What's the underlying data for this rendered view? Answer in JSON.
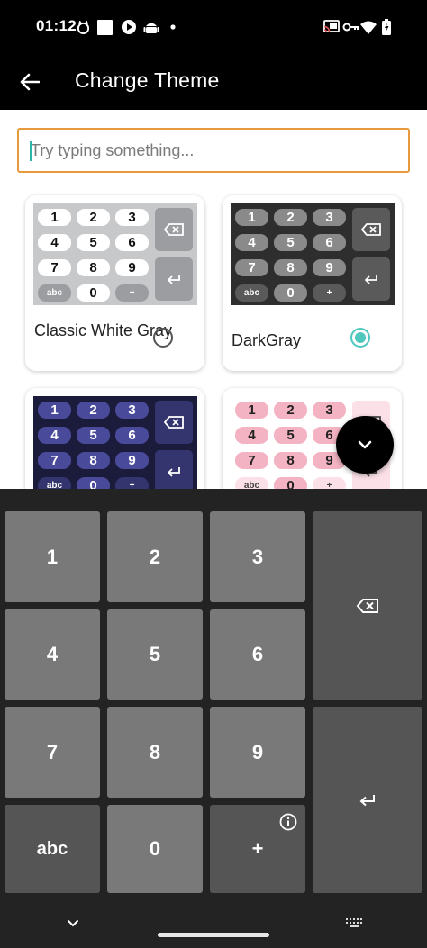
{
  "status_bar": {
    "time": "01:12"
  },
  "app_bar": {
    "title": "Change Theme"
  },
  "input": {
    "placeholder": "Try typing something..."
  },
  "themes": [
    {
      "name": "Classic White Gray",
      "selected": false,
      "keys": [
        "1",
        "2",
        "3",
        "4",
        "5",
        "6",
        "7",
        "8",
        "9",
        "abc",
        "0",
        "+"
      ]
    },
    {
      "name": "DarkGray",
      "selected": true,
      "keys": [
        "1",
        "2",
        "3",
        "4",
        "5",
        "6",
        "7",
        "8",
        "9",
        "abc",
        "0",
        "+"
      ]
    },
    {
      "name": "",
      "selected": false,
      "keys": [
        "1",
        "2",
        "3",
        "4",
        "5",
        "6",
        "7",
        "8",
        "9",
        "abc",
        "0",
        "+"
      ]
    },
    {
      "name": "",
      "selected": false,
      "keys": [
        "1",
        "2",
        "3",
        "4",
        "5",
        "6",
        "7",
        "8",
        "9",
        "abc",
        "0",
        "+"
      ]
    }
  ],
  "keyboard": {
    "keys": {
      "k1": "1",
      "k2": "2",
      "k3": "3",
      "k4": "4",
      "k5": "5",
      "k6": "6",
      "k7": "7",
      "k8": "8",
      "k9": "9",
      "abc": "abc",
      "k0": "0",
      "plus": "+"
    }
  },
  "colors": {
    "accent": "#4fc8be",
    "input_border": "#e69a3c",
    "keyboard_bg": "#232323",
    "key_light": "#797979",
    "key_dark": "#555555"
  },
  "icons": [
    "back-arrow-icon",
    "backspace-icon",
    "enter-icon",
    "info-icon",
    "chevron-down-icon",
    "keyboard-icon"
  ]
}
